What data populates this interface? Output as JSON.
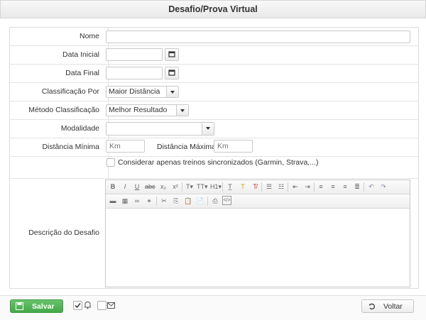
{
  "window": {
    "title": "Desafio/Prova Virtual"
  },
  "form": {
    "nome_label": "Nome",
    "nome_value": "",
    "data_inicial_label": "Data Inicial",
    "data_inicial_value": "",
    "data_final_label": "Data Final",
    "data_final_value": "",
    "classificacao_label": "Classificação Por",
    "classificacao_value": "Maior Distância",
    "metodo_label": "Método Classificação",
    "metodo_value": "Melhor Resultado",
    "modalidade_label": "Modalidade",
    "modalidade_value": "",
    "dist_min_label": "Distância Mínima",
    "dist_min_placeholder": "Km",
    "dist_max_label": "Distância Máxima",
    "dist_max_placeholder": "Km",
    "sync_label": "Considerar apenas treinos sincronizados (Garmin, Strava,...)",
    "sync_checked": false,
    "descricao_label": "Descrição do Desafio"
  },
  "editor_toolbar": {
    "row1": [
      "bold-icon",
      "italic-icon",
      "underline-icon",
      "strikethrough-icon",
      "subscript-icon",
      "superscript-icon",
      "font-family-icon",
      "font-size-icon",
      "heading-icon",
      "clear-format-icon",
      "text-color-icon",
      "remove-format-icon",
      "bullet-list-icon",
      "number-list-icon",
      "outdent-icon",
      "indent-icon",
      "align-left-icon",
      "align-center-icon",
      "align-right-icon",
      "justify-icon",
      "undo-icon",
      "redo-icon"
    ],
    "row2": [
      "horizontal-rule-icon",
      "table-icon",
      "link-icon",
      "unlink-icon",
      "cut-icon",
      "copy-icon",
      "paste-icon",
      "paste-word-icon",
      "print-icon",
      "source-icon"
    ]
  },
  "footer": {
    "save_label": "Salvar",
    "back_label": "Voltar",
    "notify_checked": true
  },
  "colors": {
    "save_green": "#4caf50",
    "border": "#dcdcdc"
  }
}
